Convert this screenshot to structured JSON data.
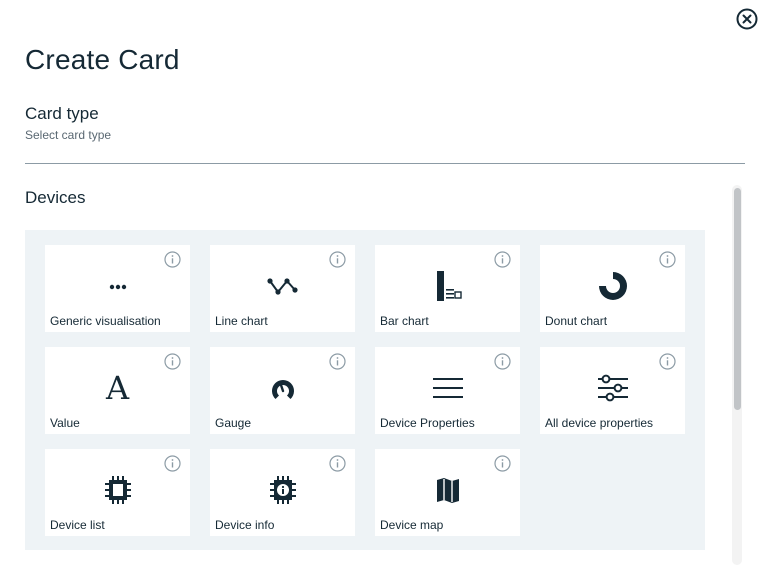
{
  "dialog": {
    "title": "Create Card",
    "close_icon": "close-circle-icon"
  },
  "card_type": {
    "heading": "Card type",
    "subheading": "Select card type"
  },
  "group": {
    "heading": "Devices",
    "cards": [
      {
        "label": "Generic visualisation",
        "icon": "ellipsis-icon"
      },
      {
        "label": "Line chart",
        "icon": "line-chart-icon"
      },
      {
        "label": "Bar chart",
        "icon": "bar-chart-icon"
      },
      {
        "label": "Donut chart",
        "icon": "donut-chart-icon"
      },
      {
        "label": "Value",
        "icon": "value-icon",
        "glyph": "A"
      },
      {
        "label": "Gauge",
        "icon": "gauge-icon"
      },
      {
        "label": "Device Properties",
        "icon": "device-properties-icon"
      },
      {
        "label": "All device properties",
        "icon": "all-device-properties-icon"
      },
      {
        "label": "Device list",
        "icon": "chip-icon"
      },
      {
        "label": "Device info",
        "icon": "chip-info-icon"
      },
      {
        "label": "Device map",
        "icon": "map-icon"
      }
    ]
  },
  "colors": {
    "text": "#152935",
    "panel_bg": "#eef3f6",
    "info_icon": "#8c9ba5"
  }
}
